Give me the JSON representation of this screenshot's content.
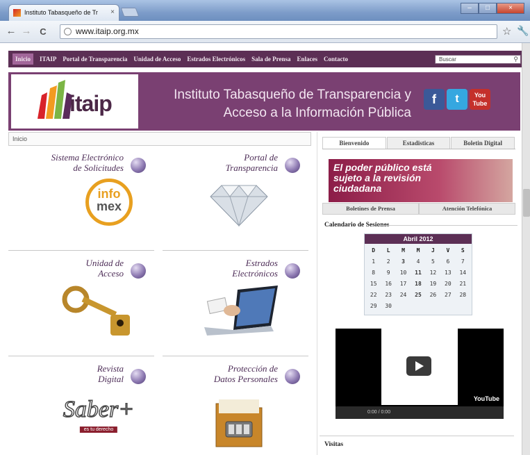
{
  "browser": {
    "tab_title": "Instituto Tabasqueño de Tr",
    "tab_close": "×",
    "url": "www.itaip.org.mx",
    "back": "←",
    "forward": "→",
    "reload": "C",
    "star": "☆",
    "wrench": "🔧"
  },
  "nav": {
    "items": [
      "Inicio",
      "ITAIP",
      "Portal de Transparencia",
      "Unidad de Acceso",
      "Estrados Electrónicos",
      "Sala de Prensa",
      "Enlaces",
      "Contacto"
    ],
    "search_placeholder": "Buscar"
  },
  "banner": {
    "logo": "itaip",
    "title_line1": "Instituto Tabasqueño de Transparencia y",
    "title_line2": "Acceso a la Información Pública",
    "social": [
      "f",
      "t",
      "You Tube"
    ]
  },
  "breadcrumb": "Inicio",
  "cards": [
    {
      "line1": "Sistema Electrónico",
      "line2": "de Solicitudes",
      "art": "infomex"
    },
    {
      "line1": "Portal de",
      "line2": "Transparencia",
      "art": "diamond"
    },
    {
      "line1": "Unidad de",
      "line2": "Acceso",
      "art": "key"
    },
    {
      "line1": "Estrados",
      "line2": "Electrónicos",
      "art": "laptop"
    },
    {
      "line1": "Revista",
      "line2": "Digital",
      "art": "saber"
    },
    {
      "line1": "Protección de",
      "line2": "Datos Personales",
      "art": "folder"
    }
  ],
  "infomex": {
    "line1": "info",
    "line2": "mex"
  },
  "saber": {
    "word": "Saber+",
    "tag": "es tu derecho"
  },
  "sidebar": {
    "tabs": [
      "Bienvenido",
      "Estadisticas",
      "Boletin Digital"
    ],
    "promo": "El poder público está sujeto a la revisión ciudadana",
    "subtabs": [
      "Boletines de Prensa",
      "Atención Telefónica"
    ],
    "calendar_title": "Calendario de Sesiones",
    "calendar_month": "Abril 2012",
    "calendar_days": [
      "D",
      "L",
      "M",
      "M",
      "J",
      "V",
      "S"
    ],
    "calendar_dates": [
      "1",
      "2",
      "3",
      "4",
      "5",
      "6",
      "7",
      "8",
      "9",
      "10",
      "11",
      "12",
      "13",
      "14",
      "15",
      "16",
      "17",
      "18",
      "19",
      "20",
      "21",
      "22",
      "23",
      "24",
      "25",
      "26",
      "27",
      "28",
      "29",
      "30"
    ],
    "video_time": "0:00 / 0:00",
    "video_logo": "YouTube",
    "visitas": "Visitas"
  },
  "colors": {
    "nav": "#5c2f55",
    "banner": "#7a4072",
    "accent": "#a2669a"
  }
}
